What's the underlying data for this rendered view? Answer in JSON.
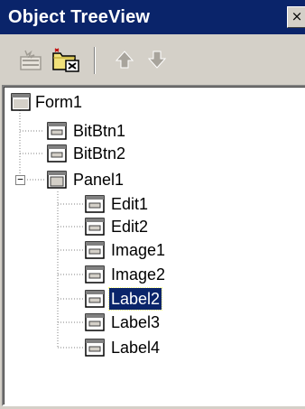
{
  "window": {
    "title": "Object TreeView",
    "close_glyph": "×"
  },
  "toolbar": {
    "buttons": [
      {
        "name": "new-item-icon",
        "enabled": false
      },
      {
        "name": "folder-delete-icon",
        "enabled": true
      },
      {
        "name": "move-up-icon",
        "enabled": false
      },
      {
        "name": "move-down-icon",
        "enabled": false
      }
    ]
  },
  "tree": {
    "nodes": [
      {
        "label": "Form1",
        "depth": 0
      },
      {
        "label": "BitBtn1",
        "depth": 1
      },
      {
        "label": "BitBtn2",
        "depth": 1
      },
      {
        "label": "Panel1",
        "depth": 1,
        "expanded": true,
        "expander": "−"
      },
      {
        "label": "Edit1",
        "depth": 2
      },
      {
        "label": "Edit2",
        "depth": 2
      },
      {
        "label": "Image1",
        "depth": 2
      },
      {
        "label": "Image2",
        "depth": 2
      },
      {
        "label": "Label2",
        "depth": 2,
        "selected": true
      },
      {
        "label": "Label3",
        "depth": 2
      },
      {
        "label": "Label4",
        "depth": 2
      }
    ]
  },
  "colors": {
    "titlebar": "#0a246a",
    "face": "#d4d0c8",
    "selection": "#0a246a",
    "tree_line": "#808080"
  }
}
